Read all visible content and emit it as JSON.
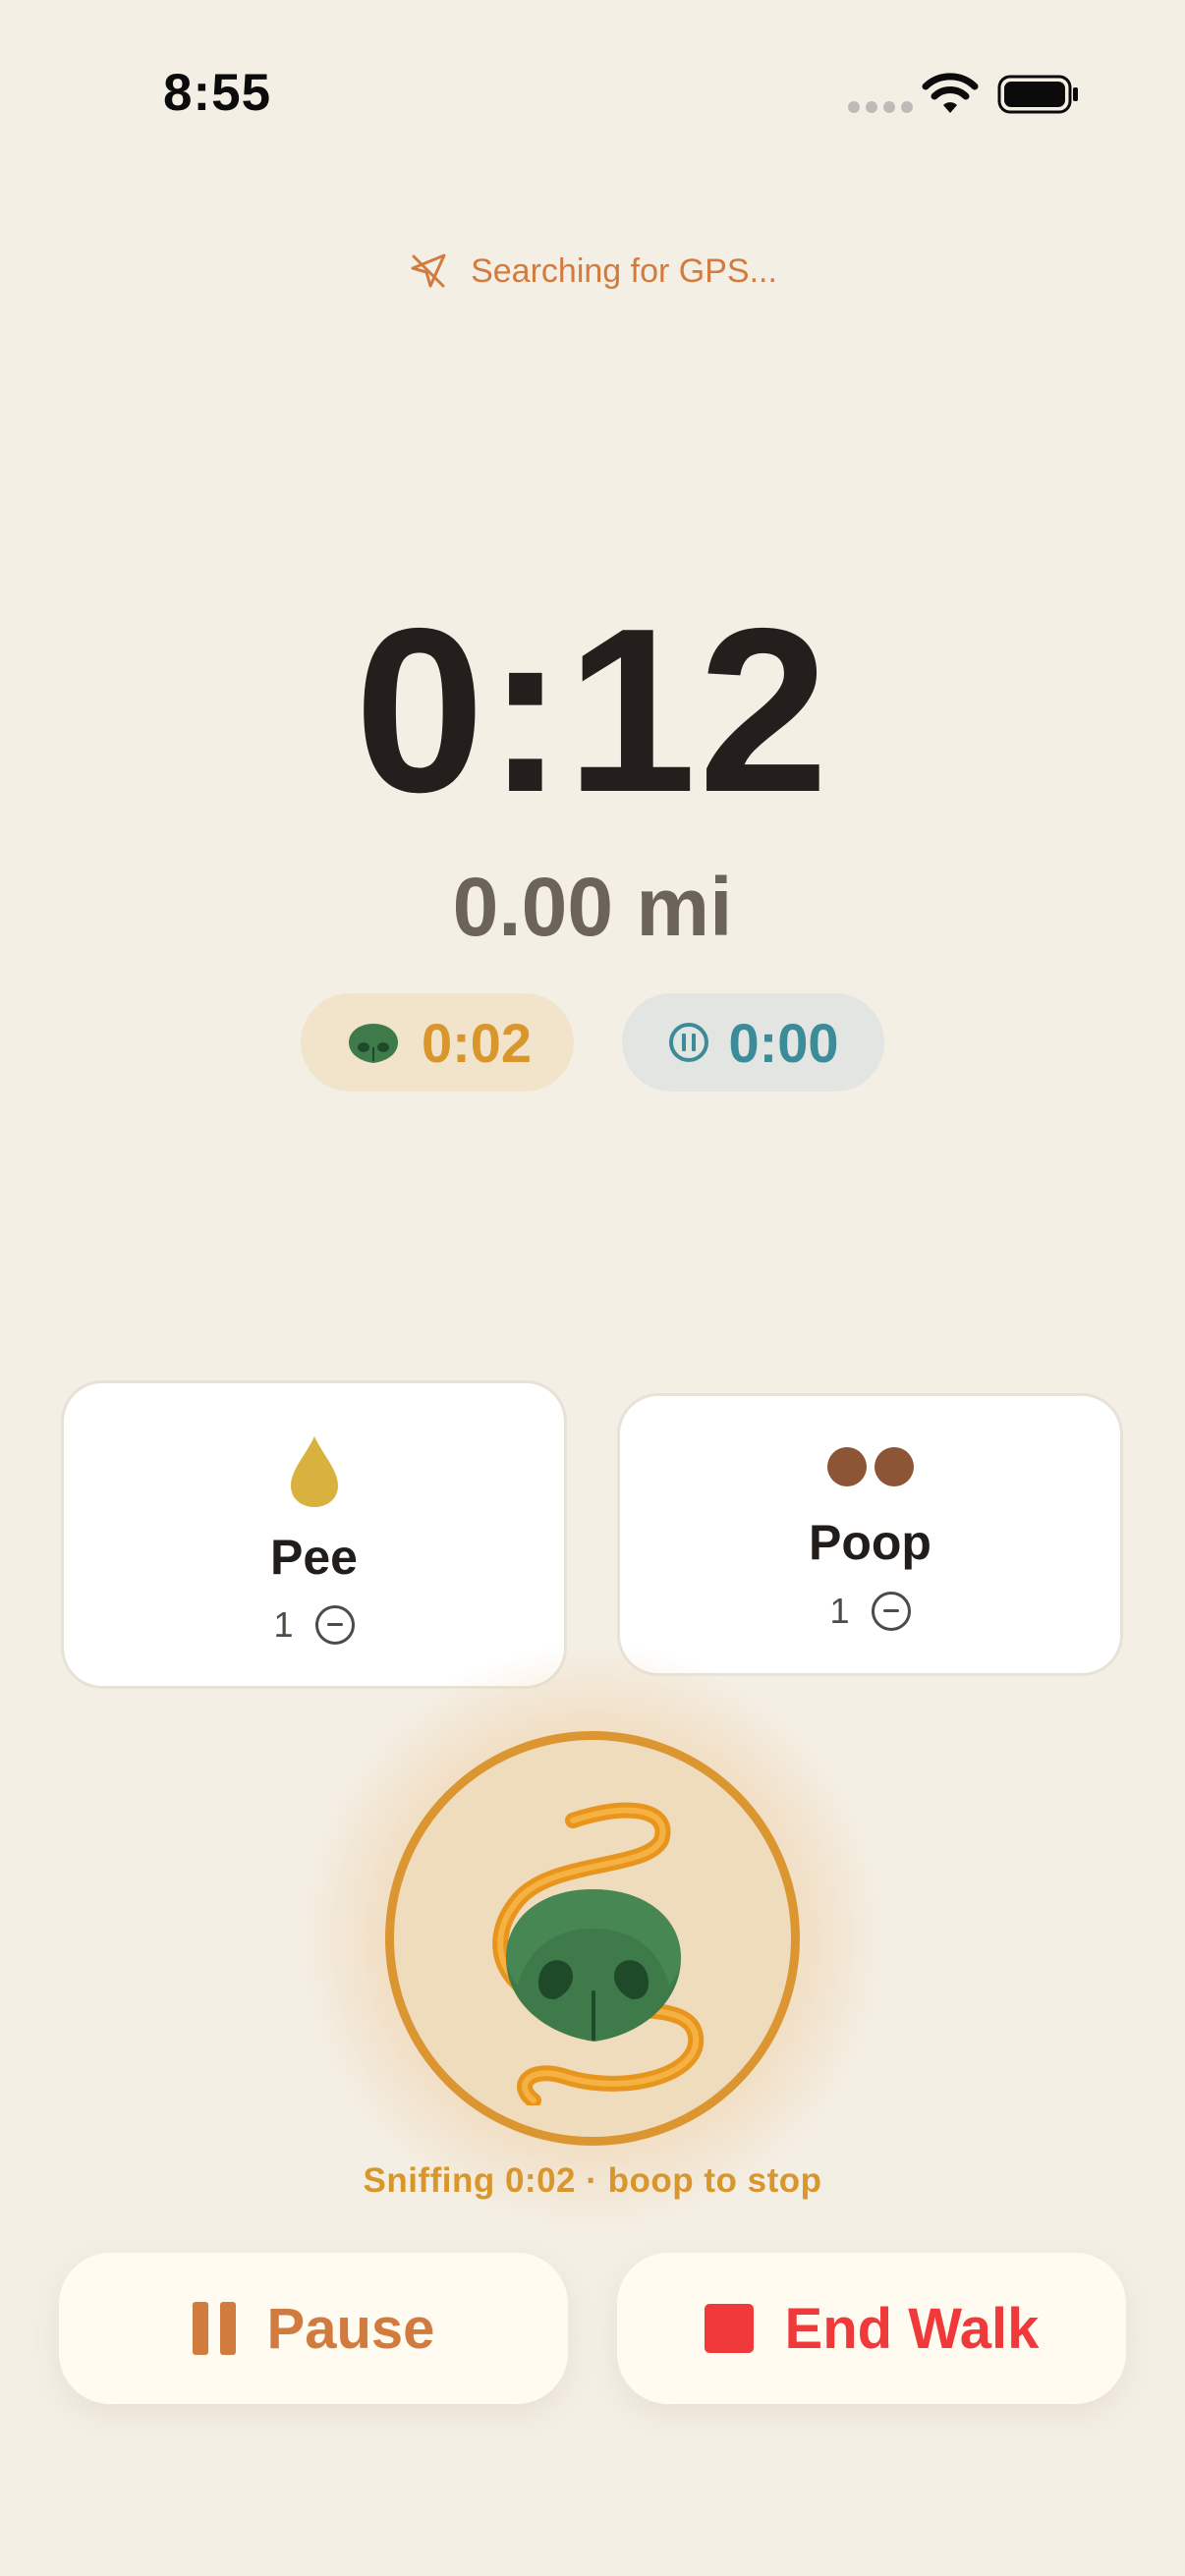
{
  "status_bar": {
    "time": "8:55"
  },
  "gps": {
    "icon": "location-arrow-icon",
    "text": "Searching for GPS..."
  },
  "walk": {
    "elapsed": "0:12",
    "distance": "0.00 mi"
  },
  "pills": {
    "sniff_time": "0:02",
    "pause_time": "0:00"
  },
  "counters": {
    "pee": {
      "label": "Pee",
      "count": "1",
      "icon": "droplet-icon"
    },
    "poop": {
      "label": "Poop",
      "count": "1",
      "icon": "poop-dots-icon"
    }
  },
  "sniff": {
    "icon": "dog-nose-icon",
    "caption": "Sniffing 0:02 · boop to stop"
  },
  "actions": {
    "pause_label": "Pause",
    "end_label": "End Walk"
  },
  "colors": {
    "background": "#f4efe5",
    "accent_orange": "#d27b3e",
    "sniff_gold": "#d8962c",
    "pause_teal": "#3c8b98",
    "end_red": "#f0393b",
    "nose_green": "#3e7a4a"
  }
}
